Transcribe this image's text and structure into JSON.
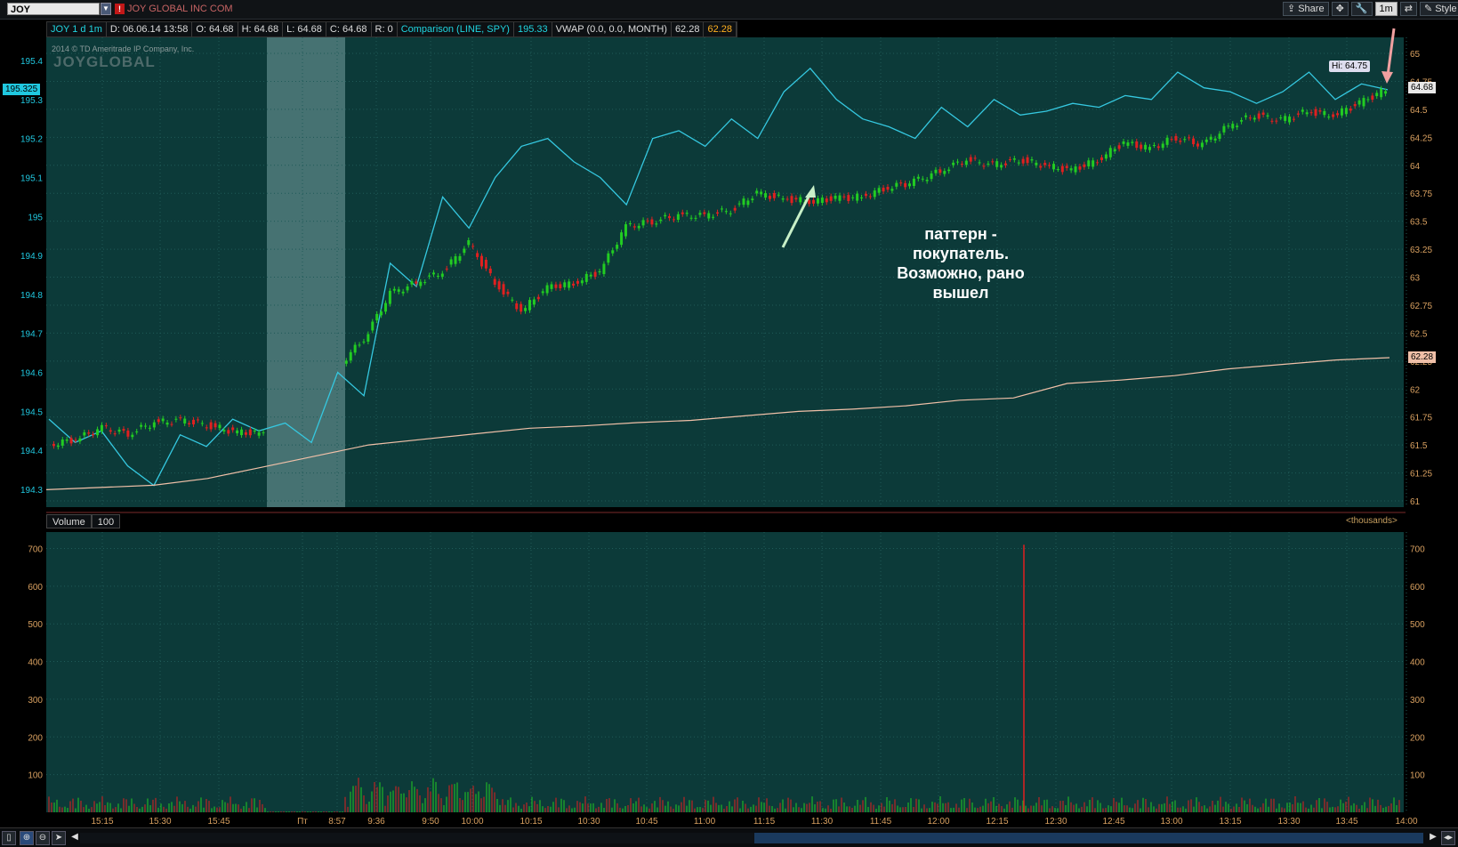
{
  "toolbar": {
    "symbol": "JOY",
    "company": "JOY GLOBAL INC COM",
    "share_label": "Share",
    "interval_label": "1m",
    "style_label": "Style"
  },
  "info": {
    "title": "JOY 1 d 1m",
    "date": "D: 06.06.14 13:58",
    "open": "O: 64.68",
    "high": "H: 64.68",
    "low": "L: 64.68",
    "close": "C: 64.68",
    "range": "R: 0",
    "comparison": "Comparison (LINE, SPY)",
    "comparison_value": "195.33",
    "vwap": "VWAP (0.0, 0.0, MONTH)",
    "vwap_value1": "62.28",
    "vwap_value2": "62.28"
  },
  "watermark": "2014 © TD Ameritrade IP Company, Inc.",
  "logo": "JOYGLOBAL",
  "annotation": "паттерн - покупатель. Возможно, рано вышел",
  "tags": {
    "spy_last": "195.325",
    "hi": "Hi: 64.75",
    "last_price": "64.68",
    "vwap_last": "62.28"
  },
  "volume_panel": {
    "label": "Volume",
    "value": "100",
    "units": "<thousands>"
  },
  "colors": {
    "background": "#0c3a39",
    "spy_line": "#35c8e0",
    "up_candle": "#22cc22",
    "down_candle": "#e02020",
    "vwap_line": "#f0c0a8",
    "grid": "#1f5a58"
  },
  "chart_data": [
    {
      "type": "line",
      "name": "price-chart",
      "y_left_ticks": [
        "195.4",
        "195.3",
        "195.2",
        "195.1",
        "195",
        "194.9",
        "194.8",
        "194.7",
        "194.6",
        "194.5",
        "194.4",
        "194.3"
      ],
      "y_right_ticks": [
        "65",
        "64.75",
        "64.5",
        "64.25",
        "64",
        "63.75",
        "63.5",
        "63.25",
        "63",
        "62.75",
        "62.5",
        "62.25",
        "62",
        "61.75",
        "61.5",
        "61.25",
        "61"
      ],
      "x_ticks": [
        "15:15",
        "15:30",
        "15:45",
        "Пт",
        "8:57",
        "9:36",
        "9:50",
        "10:00",
        "10:15",
        "10:30",
        "10:45",
        "11:00",
        "11:15",
        "11:30",
        "11:45",
        "12:00",
        "12:15",
        "12:30",
        "12:45",
        "13:00",
        "13:15",
        "13:30",
        "13:45",
        "14:00"
      ],
      "right_range": [
        61,
        65
      ],
      "left_range": [
        194.3,
        195.4
      ],
      "series": [
        {
          "name": "SPY",
          "axis": "left",
          "values": [
            194.48,
            194.42,
            194.45,
            194.36,
            194.31,
            194.44,
            194.41,
            194.48,
            194.45,
            194.47,
            194.42,
            194.6,
            194.54,
            194.88,
            194.82,
            195.05,
            194.97,
            195.1,
            195.18,
            195.2,
            195.14,
            195.1,
            195.03,
            195.2,
            195.22,
            195.18,
            195.25,
            195.2,
            195.32,
            195.38,
            195.3,
            195.25,
            195.23,
            195.2,
            195.28,
            195.23,
            195.3,
            195.26,
            195.27,
            195.29,
            195.28,
            195.31,
            195.3,
            195.37,
            195.33,
            195.32,
            195.29,
            195.32,
            195.37,
            195.3,
            195.34,
            195.325
          ]
        },
        {
          "name": "JOY",
          "axis": "right",
          "values": [
            61.5,
            61.55,
            61.65,
            61.6,
            61.7,
            61.72,
            61.68,
            61.62,
            61.6,
            61.6,
            61.82,
            62.2,
            62.45,
            62.85,
            62.95,
            63.05,
            63.3,
            62.95,
            62.7,
            62.9,
            62.95,
            63.05,
            63.45,
            63.5,
            63.55,
            63.55,
            63.6,
            63.75,
            63.7,
            63.68,
            63.7,
            63.72,
            63.8,
            63.85,
            63.95,
            64.05,
            64.0,
            64.05,
            64.0,
            63.95,
            64.05,
            64.2,
            64.15,
            64.25,
            64.18,
            64.35,
            64.45,
            64.4,
            64.48,
            64.45,
            64.55,
            64.68
          ]
        },
        {
          "name": "VWAP",
          "axis": "right",
          "values": [
            61.1,
            61.12,
            61.14,
            61.2,
            61.3,
            61.4,
            61.5,
            61.55,
            61.6,
            61.65,
            61.67,
            61.7,
            61.72,
            61.76,
            61.8,
            61.82,
            61.85,
            61.9,
            61.92,
            62.05,
            62.08,
            62.12,
            62.18,
            62.22,
            62.26,
            62.28
          ]
        }
      ]
    },
    {
      "type": "bar",
      "name": "volume-chart",
      "y_ticks": [
        "700",
        "600",
        "500",
        "400",
        "300",
        "200",
        "100"
      ],
      "ylim": [
        0,
        720
      ],
      "spike": {
        "time": "12:23",
        "value": 710
      }
    }
  ]
}
